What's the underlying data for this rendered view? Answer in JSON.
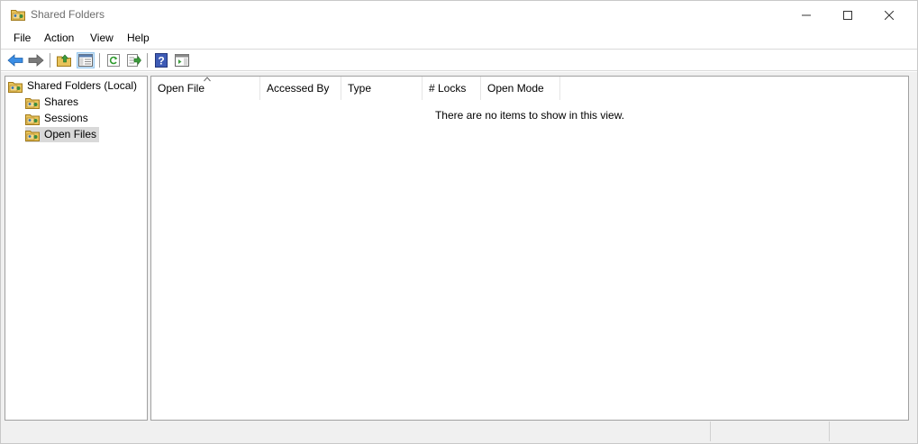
{
  "window": {
    "title": "Shared Folders",
    "title_icon": "shared-folder-icon"
  },
  "menu": {
    "file": "File",
    "action": "Action",
    "view": "View",
    "help": "Help"
  },
  "toolbar": {
    "buttons": [
      "back-arrow-icon",
      "forward-arrow-icon",
      "up-folder-icon",
      "show-hide-tree-icon",
      "refresh-icon",
      "export-list-icon",
      "help-icon",
      "action-pane-icon"
    ]
  },
  "tree": {
    "root": "Shared Folders (Local)",
    "items": [
      {
        "label": "Shares"
      },
      {
        "label": "Sessions"
      },
      {
        "label": "Open Files"
      }
    ],
    "selected": "Open Files"
  },
  "list": {
    "columns": [
      "Open File",
      "Accessed By",
      "Type",
      "# Locks",
      "Open Mode"
    ],
    "sort_column": "Open File",
    "empty_message": "There are no items to show in this view."
  },
  "colors": {
    "accent": "#1e78d7",
    "selection": "#d9d9d9",
    "pressed": "#cce4f7"
  }
}
